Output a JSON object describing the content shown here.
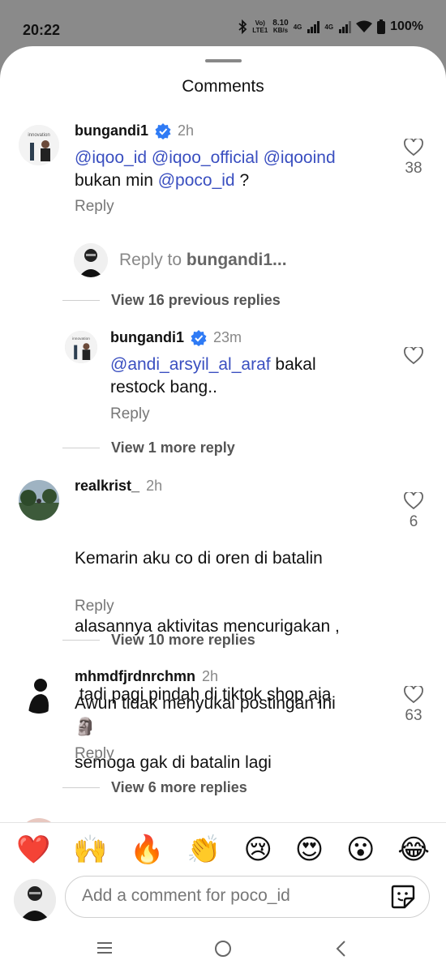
{
  "status_bar": {
    "time": "20:22",
    "volte": "Vo)",
    "lte": "LTE1",
    "speed_value": "8.10",
    "speed_unit": "KB/s",
    "net1": "4G",
    "net2": "4G",
    "battery": "100%"
  },
  "sheet": {
    "title": "Comments"
  },
  "comments": [
    {
      "username": "bungandi1",
      "time": "2h",
      "verified": true,
      "mentions_line1": [
        "@iqoo_id",
        "@iqoo_official",
        "@iqooind"
      ],
      "text_line2_prefix": "bukan min ",
      "text_line2_mention": "@poco_id",
      "text_line2_suffix": " ?",
      "reply_label": "Reply",
      "likes": "38"
    },
    {
      "username": "realkrist_",
      "time": "2h",
      "text_lines": [
        "Kemarin aku co di oren di batalin",
        "alasannya aktivitas mencurigakan ,",
        " tadi pagi pindah di tiktok shop aja",
        "semoga gak di batalin lagi"
      ],
      "reply_label": "Reply",
      "likes": "6",
      "view_more": "View 10 more replies"
    },
    {
      "username": "mhmdfjrdnrchmn",
      "time": "2h",
      "text_line1": "Awun tidak menyukai postingan ini",
      "emoji": "🗿",
      "reply_label": "Reply",
      "likes": "63",
      "view_more": "View 6 more replies"
    }
  ],
  "reply_prompt": {
    "prefix": "Reply to ",
    "username": "bungandi1..."
  },
  "thread": {
    "view_previous": "View 16 previous replies",
    "reply": {
      "username": "bungandi1",
      "time": "23m",
      "verified": true,
      "mention": "@andi_arsyil_al_araf",
      "text_line1_suffix": " bakal",
      "text_line2": "restock bang..",
      "reply_label": "Reply"
    },
    "view_more": "View 1 more reply"
  },
  "emoji_bar": [
    "❤️",
    "🙌",
    "🔥",
    "👏",
    "😢",
    "😍",
    "😮",
    "😂"
  ],
  "composer": {
    "placeholder": "Add a comment for poco_id"
  },
  "colors": {
    "mention": "#3a4fc0",
    "verified": "#2f7bf5",
    "heart": "#e0202b"
  }
}
